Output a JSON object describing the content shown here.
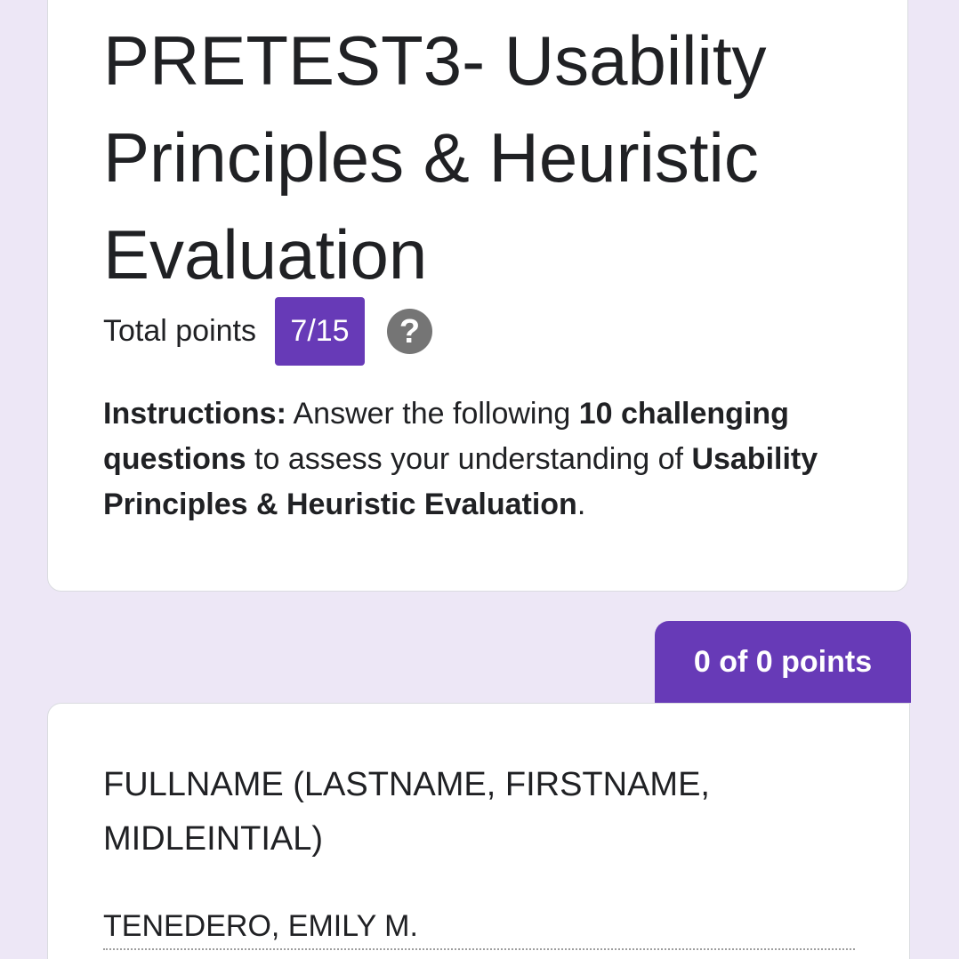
{
  "form": {
    "title": "PRETEST3- Usability Principles & Heuristic Evaluation",
    "total_points_label": "Total points",
    "total_points_value": "7/15",
    "help_icon": "question-mark-icon",
    "help_glyph": "?",
    "description": {
      "instructions_label": "Instructions:",
      "text_1": " Answer the following ",
      "bold_count": "10 challenging questions",
      "text_2": " to assess your understanding of ",
      "bold_topic": "Usability Principles & Heuristic Evaluation",
      "text_3": "."
    }
  },
  "section": {
    "score_label": "0 of 0 points"
  },
  "question": {
    "title": "FULLNAME (LASTNAME, FIRSTNAME, MIDLEINTIAL)",
    "answer": "TENEDERO, EMILY M."
  },
  "colors": {
    "background": "#ede7f6",
    "accent": "#673ab7",
    "help_icon": "#757575",
    "card": "#ffffff"
  }
}
